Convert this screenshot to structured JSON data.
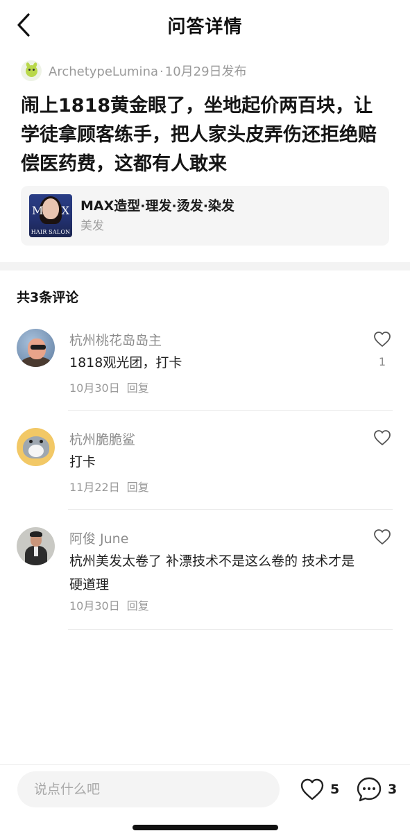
{
  "header": {
    "title": "问答详情"
  },
  "author": {
    "name": "ArchetypeLumina",
    "separator": "·",
    "date": "10月29日发布"
  },
  "post": {
    "title": "闹上1818黄金眼了，坐地起价两百块，让学徒拿顾客练手，把人家头皮弄伤还拒绝赔偿医药费，这都有人敢来"
  },
  "shop": {
    "name": "MAX造型·理发·烫发·染发",
    "category": "美发",
    "thumb_text": {
      "m": "M",
      "x": "X",
      "salon": "HAIR SALON"
    }
  },
  "comments": {
    "count_label": "共3条评论",
    "items": [
      {
        "name": "杭州桃花岛岛主",
        "text": "1818观光团，打卡",
        "date": "10月30日",
        "reply": "回复",
        "likes": "1"
      },
      {
        "name": "杭州脆脆鲨",
        "text": "打卡",
        "date": "11月22日",
        "reply": "回复",
        "likes": ""
      },
      {
        "name": "阿俊 June",
        "text": "杭州美发太卷了 补漂技术不是这么卷的 技术才是硬道理",
        "date": "10月30日",
        "reply": "回复",
        "likes": ""
      }
    ]
  },
  "bottom": {
    "input_placeholder": "说点什么吧",
    "like_count": "5",
    "comment_count": "3"
  },
  "icons": {
    "back": "back-arrow-icon",
    "like": "heart-icon",
    "comment": "comment-bubble-icon"
  },
  "colors": {
    "text": "#1a1a1a",
    "muted": "#9a9a9a",
    "card_bg": "#f5f5f5"
  }
}
